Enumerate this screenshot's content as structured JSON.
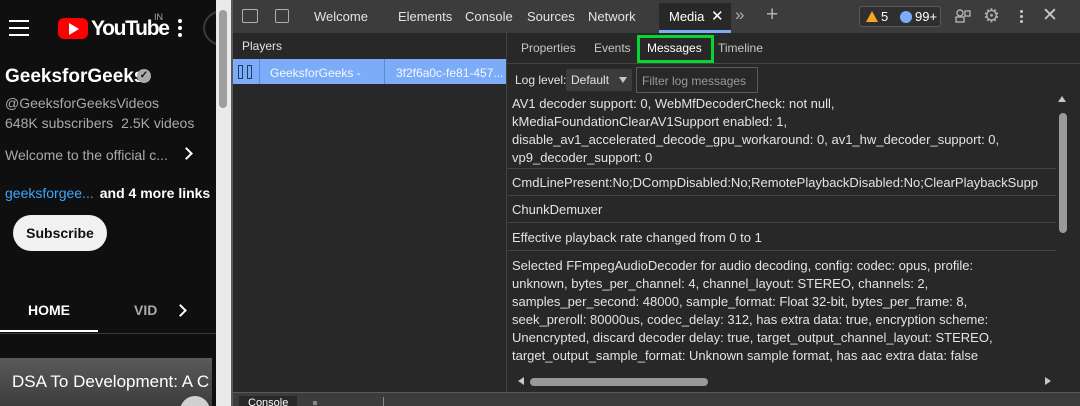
{
  "youtube": {
    "logo_text": "YouTube",
    "country": "IN",
    "channel_name": "GeeksforGeeks",
    "handle": "@GeeksforGeeksVideos",
    "subscribers": "648K subscribers",
    "videos": "2.5K videos",
    "description": "Welcome to the official c...",
    "link_text": "geeksforgee...",
    "more_links": "and 4 more links",
    "subscribe_label": "Subscribe",
    "tab_home": "HOME",
    "tab_videos": "VID",
    "thumbnail_title": "DSA To Development: A C",
    "colors": {
      "brand_red": "#ff0000",
      "link_blue": "#3ea6ff"
    }
  },
  "devtools": {
    "tabs": [
      "Welcome",
      "Elements",
      "Console",
      "Sources",
      "Network"
    ],
    "active_tab": "Media",
    "warnings_count": "5",
    "issues_count": "99+",
    "players_title": "Players",
    "player": {
      "name": "GeeksforGeeks -",
      "id": "3f2f6a0c-fe81-457..."
    },
    "subtabs": [
      "Properties",
      "Events",
      "Messages",
      "Timeline"
    ],
    "active_subtab": "Messages",
    "log_level_label": "Log level:",
    "log_level_value": "Default",
    "filter_placeholder": "Filter log messages",
    "messages": [
      {
        "lines": [
          "AV1 decoder support: 0, WebMfDecoderCheck: not null,",
          "kMediaFoundationClearAV1Support enabled: 1,",
          "disable_av1_accelerated_decode_gpu_workaround: 0, av1_hw_decoder_support: 0,",
          "vp9_decoder_support: 0"
        ]
      },
      {
        "lines": [
          "CmdLinePresent:No;DCompDisabled:No;RemotePlaybackDisabled:No;ClearPlaybackSupp"
        ]
      },
      {
        "lines": [
          "ChunkDemuxer"
        ]
      },
      {
        "lines": [
          "Effective playback rate changed from 0 to 1"
        ]
      },
      {
        "lines": [
          "Selected FFmpegAudioDecoder for audio decoding, config: codec: opus, profile:",
          "unknown, bytes_per_channel: 4, channel_layout: STEREO, channels: 2,",
          "samples_per_second: 48000, sample_format: Float 32-bit, bytes_per_frame: 8,",
          "seek_preroll: 80000us, codec_delay: 312, has extra data: true, encryption scheme:",
          "Unencrypted, discard decoder delay: true, target_output_channel_layout: STEREO,",
          "target_output_sample_format: Unknown sample format, has aac extra data: false"
        ]
      }
    ],
    "drawer_tab": "Console",
    "colors": {
      "accent": "#7cacf8",
      "highlight_box": "#0ad434",
      "warning": "#f6a623"
    }
  }
}
